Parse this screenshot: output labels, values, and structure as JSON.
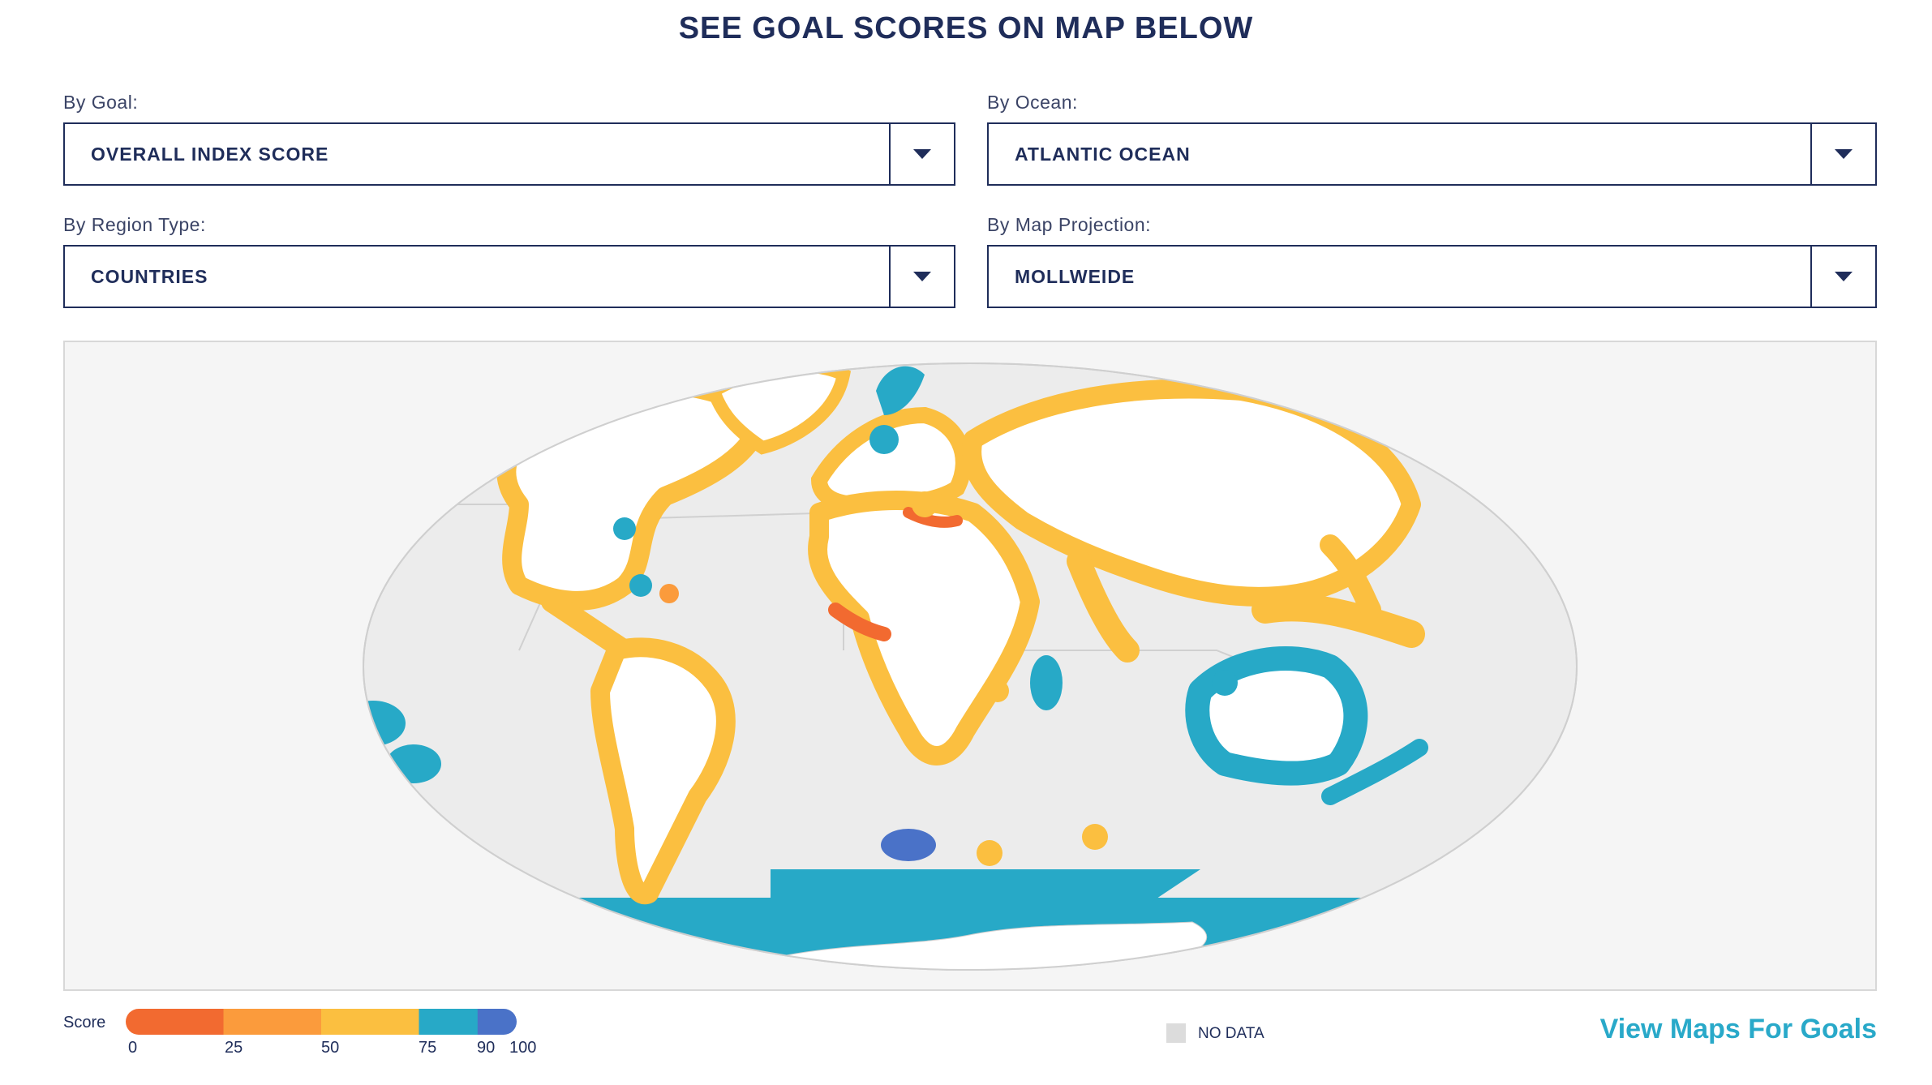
{
  "header": {
    "title": "SEE GOAL SCORES ON MAP BELOW"
  },
  "filters": {
    "goal": {
      "label": "By Goal:",
      "value": "OVERALL INDEX SCORE"
    },
    "ocean": {
      "label": "By Ocean:",
      "value": "ATLANTIC OCEAN"
    },
    "region": {
      "label": "By Region Type:",
      "value": "COUNTRIES"
    },
    "projection": {
      "label": "By Map Projection:",
      "value": "MOLLWEIDE"
    }
  },
  "legend": {
    "label": "Score",
    "ticks": [
      "0",
      "25",
      "50",
      "75",
      "90",
      "100"
    ],
    "bands": [
      {
        "from": 0,
        "to": 25,
        "color": "#f26a30"
      },
      {
        "from": 25,
        "to": 50,
        "color": "#fb9b3c"
      },
      {
        "from": 50,
        "to": 75,
        "color": "#fbbf40"
      },
      {
        "from": 75,
        "to": 90,
        "color": "#27a9c7"
      },
      {
        "from": 90,
        "to": 100,
        "color": "#4a72c8"
      }
    ],
    "no_data_label": "NO DATA",
    "no_data_color": "#dcdcdc"
  },
  "links": {
    "view_goals": "View Maps For Goals"
  },
  "colors": {
    "navy": "#1f2d5a",
    "accent": "#29a9c9",
    "land": "#ffffff",
    "ocean_bg": "#ececec"
  }
}
